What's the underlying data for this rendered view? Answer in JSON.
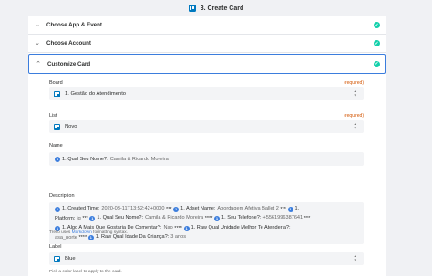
{
  "header": {
    "title": "3. Create Card",
    "icon": "trello-icon"
  },
  "sections": [
    {
      "label": "Choose App & Event",
      "status": "complete"
    },
    {
      "label": "Choose Account",
      "status": "complete"
    },
    {
      "label": "Customize Card",
      "status": "complete",
      "expanded": true
    }
  ],
  "fields": {
    "board": {
      "label": "Board",
      "required": "(required)",
      "value": "1. Gestão do Atendimento"
    },
    "list": {
      "label": "List",
      "required": "(required)",
      "value": "Novo"
    },
    "name": {
      "label": "Name",
      "token_key": "1. Qual Seu Nome?:",
      "token_value": "Camila & Ricardo Moreira"
    },
    "description": {
      "label": "Description",
      "line1": {
        "k1": "1. Created Time:",
        "v1": "2020-03-11T13:52:42+0000",
        "sep1": "***",
        "k2": "1. Adset Name:",
        "v2": "Abordagem Afetiva Ballet 2",
        "sep2": "***",
        "k3": "1."
      },
      "line2": {
        "k1": "Platform:",
        "v1": "ig",
        "sep1": "***",
        "k2": "1. Qual Seu Nome?:",
        "v2": "Camila & Ricardo Moreira",
        "sep2": "****",
        "k3": "1. Seu Telefone?:",
        "v3": "+5561996387641",
        "sep3": "***"
      },
      "line3": {
        "k1": "1. Algo A Mais Que Gostaria De Comentar?:",
        "v1": "Nao",
        "sep1": "****",
        "k2": "1. Raw Qual Unidade Melhor Te Atenderia?:"
      },
      "line4": {
        "v0": "asa_norte",
        "sep0": "****",
        "k1": "1. Raw Qual Idade Da Criança?:",
        "v1": "3 anos"
      }
    },
    "markdown_hint": {
      "before": "Trello uses",
      "link": "Markdown",
      "after": "formatting syntax."
    },
    "label": {
      "label": "Label",
      "value": "Blue",
      "hint": "Pick a color label to apply to the card."
    }
  },
  "colors": {
    "accent": "#3b7ddd",
    "check": "#13d0ab",
    "required": "#d35400",
    "trello": "#0079bf"
  }
}
